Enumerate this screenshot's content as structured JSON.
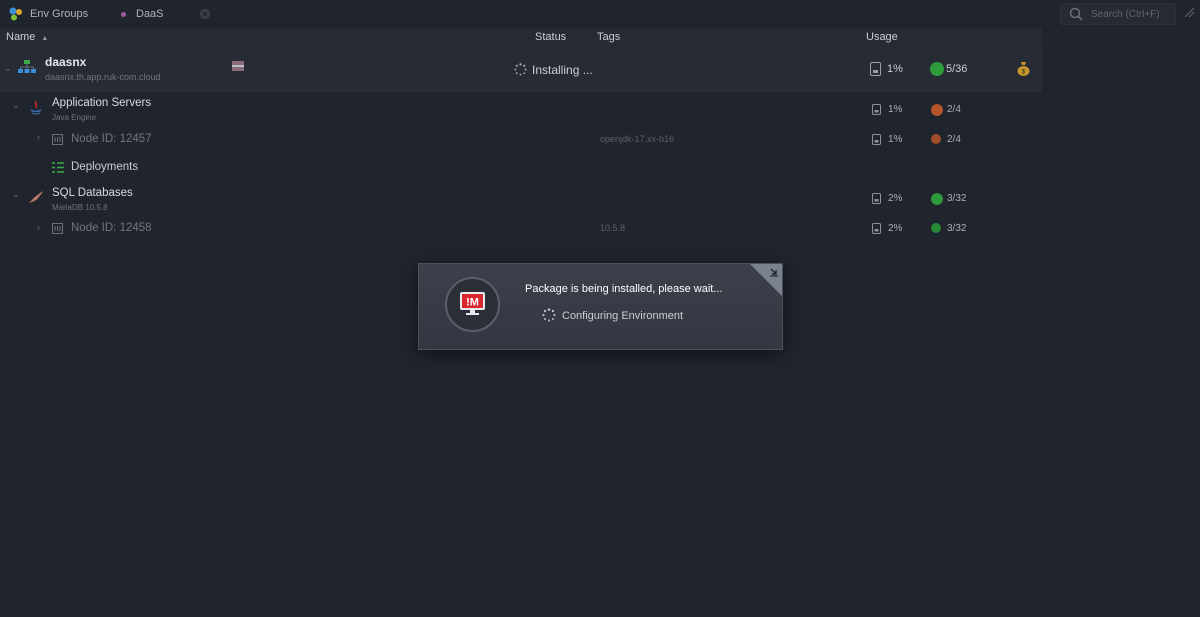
{
  "topbar": {
    "env_groups_label": "Env Groups",
    "daas_label": "DaaS",
    "search_placeholder": "Search (Ctrl+F)"
  },
  "columns": {
    "name": "Name",
    "status": "Status",
    "tags": "Tags",
    "usage": "Usage"
  },
  "environment": {
    "name": "daasnx",
    "domain": "daasnx.th.app.ruk-com.cloud",
    "status": "Installing ...",
    "usage_pct": "1%",
    "cloudlets": "5/36"
  },
  "groups": [
    {
      "title": "Application Servers",
      "subtitle": "Java Engine",
      "usage_pct": "1%",
      "cloudlets": "2/4",
      "node": {
        "label": "Node ID: 12457",
        "tag": "openjdk-17.xx-b16",
        "usage_pct": "1%",
        "cloudlets": "2/4"
      },
      "deployments": "Deployments"
    },
    {
      "title": "SQL Databases",
      "subtitle": "MariaDB 10.5.8",
      "usage_pct": "2%",
      "cloudlets": "3/32",
      "node": {
        "label": "Node ID: 12458",
        "tag": "10.5.8",
        "usage_pct": "2%",
        "cloudlets": "3/32"
      }
    }
  ],
  "dialog": {
    "message": "Package is being installed, please wait...",
    "step": "Configuring Environment",
    "logo_text": "!M"
  },
  "colors": {
    "background": "#20242c",
    "status_green": "#2e9b3a",
    "status_orange": "#b5552c",
    "logo_red": "#d9262c"
  }
}
